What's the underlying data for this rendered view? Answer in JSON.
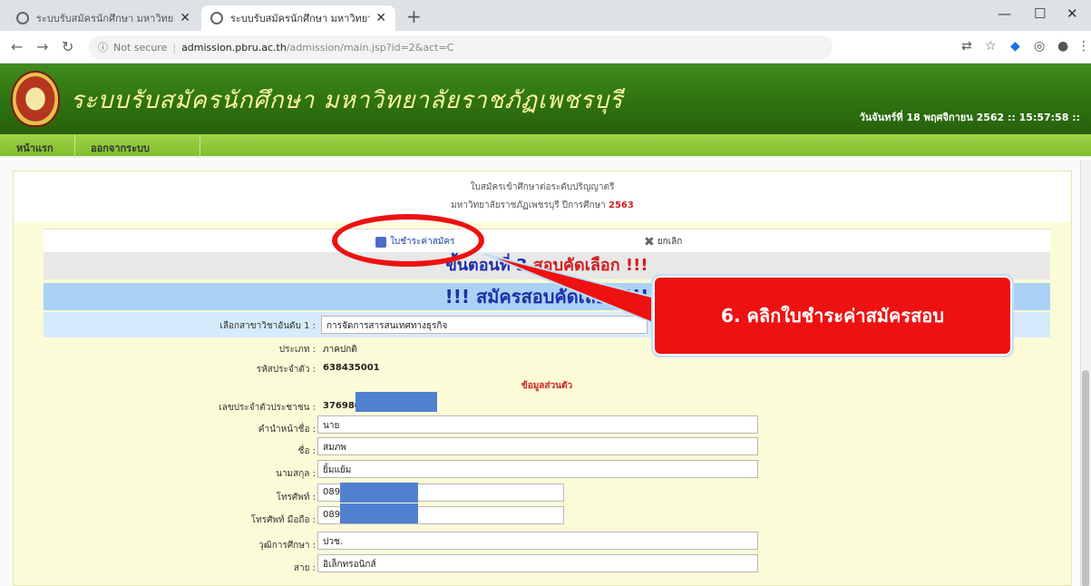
{
  "browser": {
    "tabs": [
      {
        "title": "ระบบรับสมัครนักศึกษา มหาวิทยาลัย",
        "active": false
      },
      {
        "title": "ระบบรับสมัครนักศึกษา มหาวิทยาลัย",
        "active": true
      }
    ],
    "new_tab_icon": "plus-icon",
    "address": {
      "security": "Not secure",
      "host": "admission.pbru.ac.th",
      "path": "/admission/main.jsp?id=2&act=C"
    }
  },
  "site": {
    "title": "ระบบรับสมัครนักศึกษา มหาวิทยาลัยราชภัฏเพชรบุรี",
    "date_text": "วันจันทร์ที่ 18 พฤศจิกายน 2562 :: 15:57:58 ::",
    "menu": [
      "หน้าแรก",
      "ออกจากระบบ"
    ]
  },
  "form": {
    "heading_line1": "ใบสมัครเข้าศึกษาต่อระดับปริญญาตรี",
    "heading_line2": "มหาวิทยาลัยราชภัฏเพชรบุรี ปีการศึกษา",
    "heading_year": "2563",
    "print_link": "ใบชำระค่าสมัคร",
    "cancel_link": "ยกเลิก",
    "step_prefix": "ขั้นตอนที่ 3",
    "step_suffix": "สอบคัดเลือก !!!",
    "banner": "!!! สมัครสอบคัดเลือก !!!",
    "branch_label": "เลือกสาขาวิชาอันดับ 1 :",
    "branch_value": "การจัดการสารสนเทศทางธุรกิจ",
    "type_label": "ประเภท :",
    "type_value": "ภาคปกติ",
    "applicant_id_label": "รหัสประจำตัว :",
    "applicant_id_value": "638435001",
    "section_title": "ข้อมูลส่วนตัว",
    "fields": [
      {
        "label": "เลขประจำตัวประชาชน :",
        "value": "376980"
      },
      {
        "label": "คำนำหน้าชื่อ :",
        "value": "นาย"
      },
      {
        "label": "ชื่อ :",
        "value": "สมภพ"
      },
      {
        "label": "นามสกุล :",
        "value": "ยิ้มแย้ม"
      },
      {
        "label": "โทรศัพท์ :",
        "value": "089"
      },
      {
        "label": "โทรศัพท์ มือถือ :",
        "value": "089"
      },
      {
        "label": "วุฒิการศึกษา :",
        "value": "ปวช."
      },
      {
        "label": "สาย :",
        "value": "อิเล็กทรอนิกส์"
      }
    ]
  },
  "annotation": {
    "callout_number": "6.",
    "callout_text": "คลิกใบชำระค่าสมัครสอบ",
    "color": "#ee1111"
  }
}
